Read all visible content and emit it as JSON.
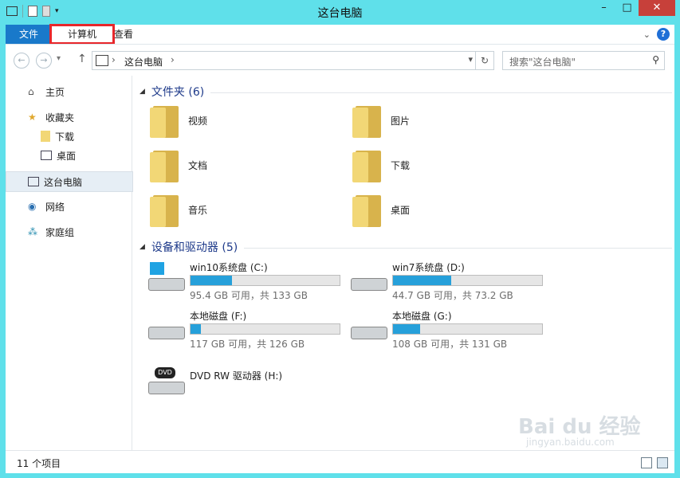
{
  "window": {
    "title": "这台电脑"
  },
  "ribbon": {
    "file_tab": "文件",
    "computer_tab": "计算机",
    "view_tab": "查看",
    "help": "?"
  },
  "address": {
    "crumb": "这台电脑",
    "search_placeholder": "搜索\"这台电脑\""
  },
  "nav": {
    "home": "主页",
    "favorites": "收藏夹",
    "downloads": "下载",
    "desktop": "桌面",
    "this_pc": "这台电脑",
    "network": "网络",
    "homegroup": "家庭组"
  },
  "folders_section": {
    "title": "文件夹 (6)"
  },
  "folders": [
    {
      "name": "视频"
    },
    {
      "name": "图片"
    },
    {
      "name": "文档"
    },
    {
      "name": "下载"
    },
    {
      "name": "音乐"
    },
    {
      "name": "桌面"
    }
  ],
  "devices_section": {
    "title": "设备和驱动器 (5)"
  },
  "drives": [
    {
      "name": "win10系统盘 (C:)",
      "info": "95.4 GB 可用，共 133 GB",
      "used_fraction": 0.28
    },
    {
      "name": "win7系统盘 (D:)",
      "info": "44.7 GB 可用，共 73.2 GB",
      "used_fraction": 0.39
    },
    {
      "name": "本地磁盘 (F:)",
      "info": "117 GB 可用，共 126 GB",
      "used_fraction": 0.07
    },
    {
      "name": "本地磁盘 (G:)",
      "info": "108 GB 可用，共 131 GB",
      "used_fraction": 0.18
    },
    {
      "name": "DVD RW 驱动器 (H:)",
      "info": ""
    }
  ],
  "status": {
    "count": "11 个项目"
  },
  "watermark": {
    "main": "Bai du 经验",
    "sub": "jingyan.baidu.com"
  }
}
